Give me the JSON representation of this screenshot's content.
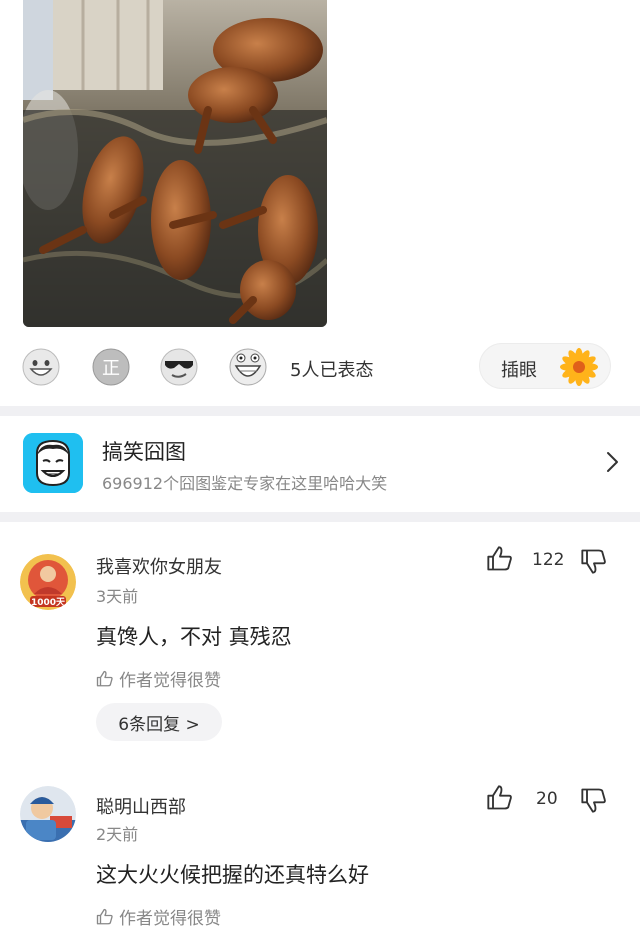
{
  "post": {
    "image_alt": "roasted dogs on straw"
  },
  "reactions": {
    "emojis": [
      "grin-emoji",
      "zheng-emoji",
      "sunglasses-emoji",
      "laughing-emoji"
    ],
    "count_text": "5人已表态",
    "stick_label": "插眼"
  },
  "topic": {
    "title": "搞笑囧图",
    "description": "696912个囧图鉴定专家在这里哈哈大笑"
  },
  "comments": [
    {
      "username": "我喜欢你女朋友",
      "time": "3天前",
      "text": "真馋人，不对 真残忍",
      "author_like": "作者觉得很赞",
      "likes": "122",
      "reply_label": "6条回复 >",
      "badge": "1000天"
    },
    {
      "username": "聪明山西部",
      "time": "2天前",
      "text": "这大火火候把握的还真特么好",
      "author_like": "作者觉得很赞",
      "likes": "20"
    }
  ],
  "colors": {
    "accent_blue": "#1fbff0",
    "divider": "#f0f0f3",
    "muted_text": "#888888"
  }
}
